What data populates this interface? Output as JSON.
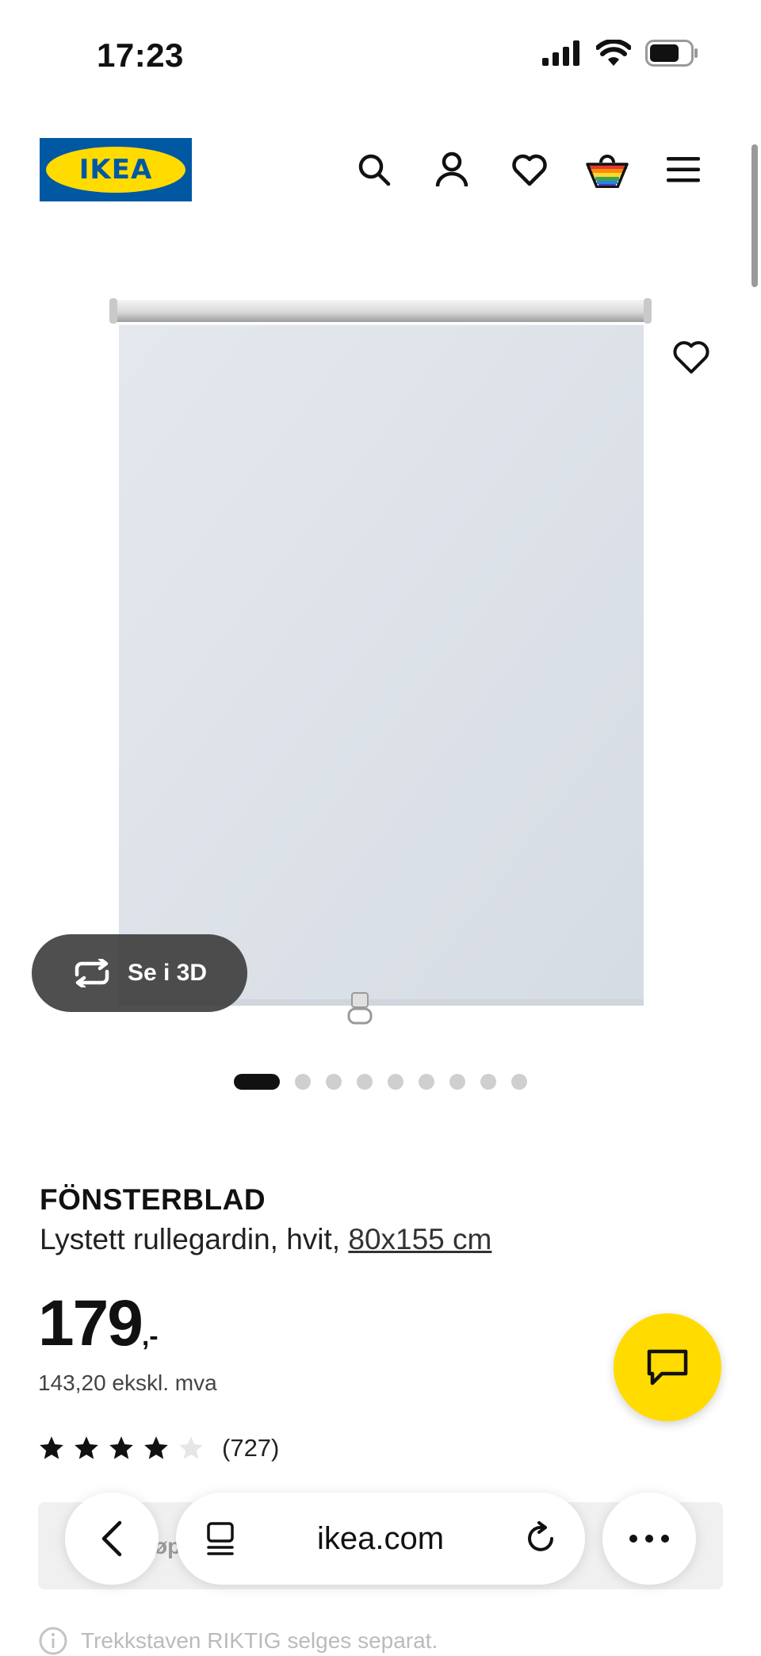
{
  "status": {
    "time": "17:23"
  },
  "header": {
    "logo_text": "IKEA"
  },
  "media": {
    "view3d_label": "Se i 3D",
    "dots_total": 9,
    "dot_active_index": 0
  },
  "product": {
    "name": "FÖNSTERBLAD",
    "desc_main": "Lystett rullegardin, hvit, ",
    "desc_size": "80x155 cm",
    "price_int": "179",
    "price_suffix": ",-",
    "price_ex_vat": "143,20 ekskl. mva",
    "rating_stars": 4,
    "rating_max": 5,
    "review_count": "(727)"
  },
  "partial": {
    "obscured_button_text": "øp",
    "note": "Trekkstaven RIKTIG selges separat."
  },
  "browser": {
    "url": "ikea.com"
  },
  "colors": {
    "brand_blue": "#0058a3",
    "brand_yellow": "#ffdb00"
  }
}
